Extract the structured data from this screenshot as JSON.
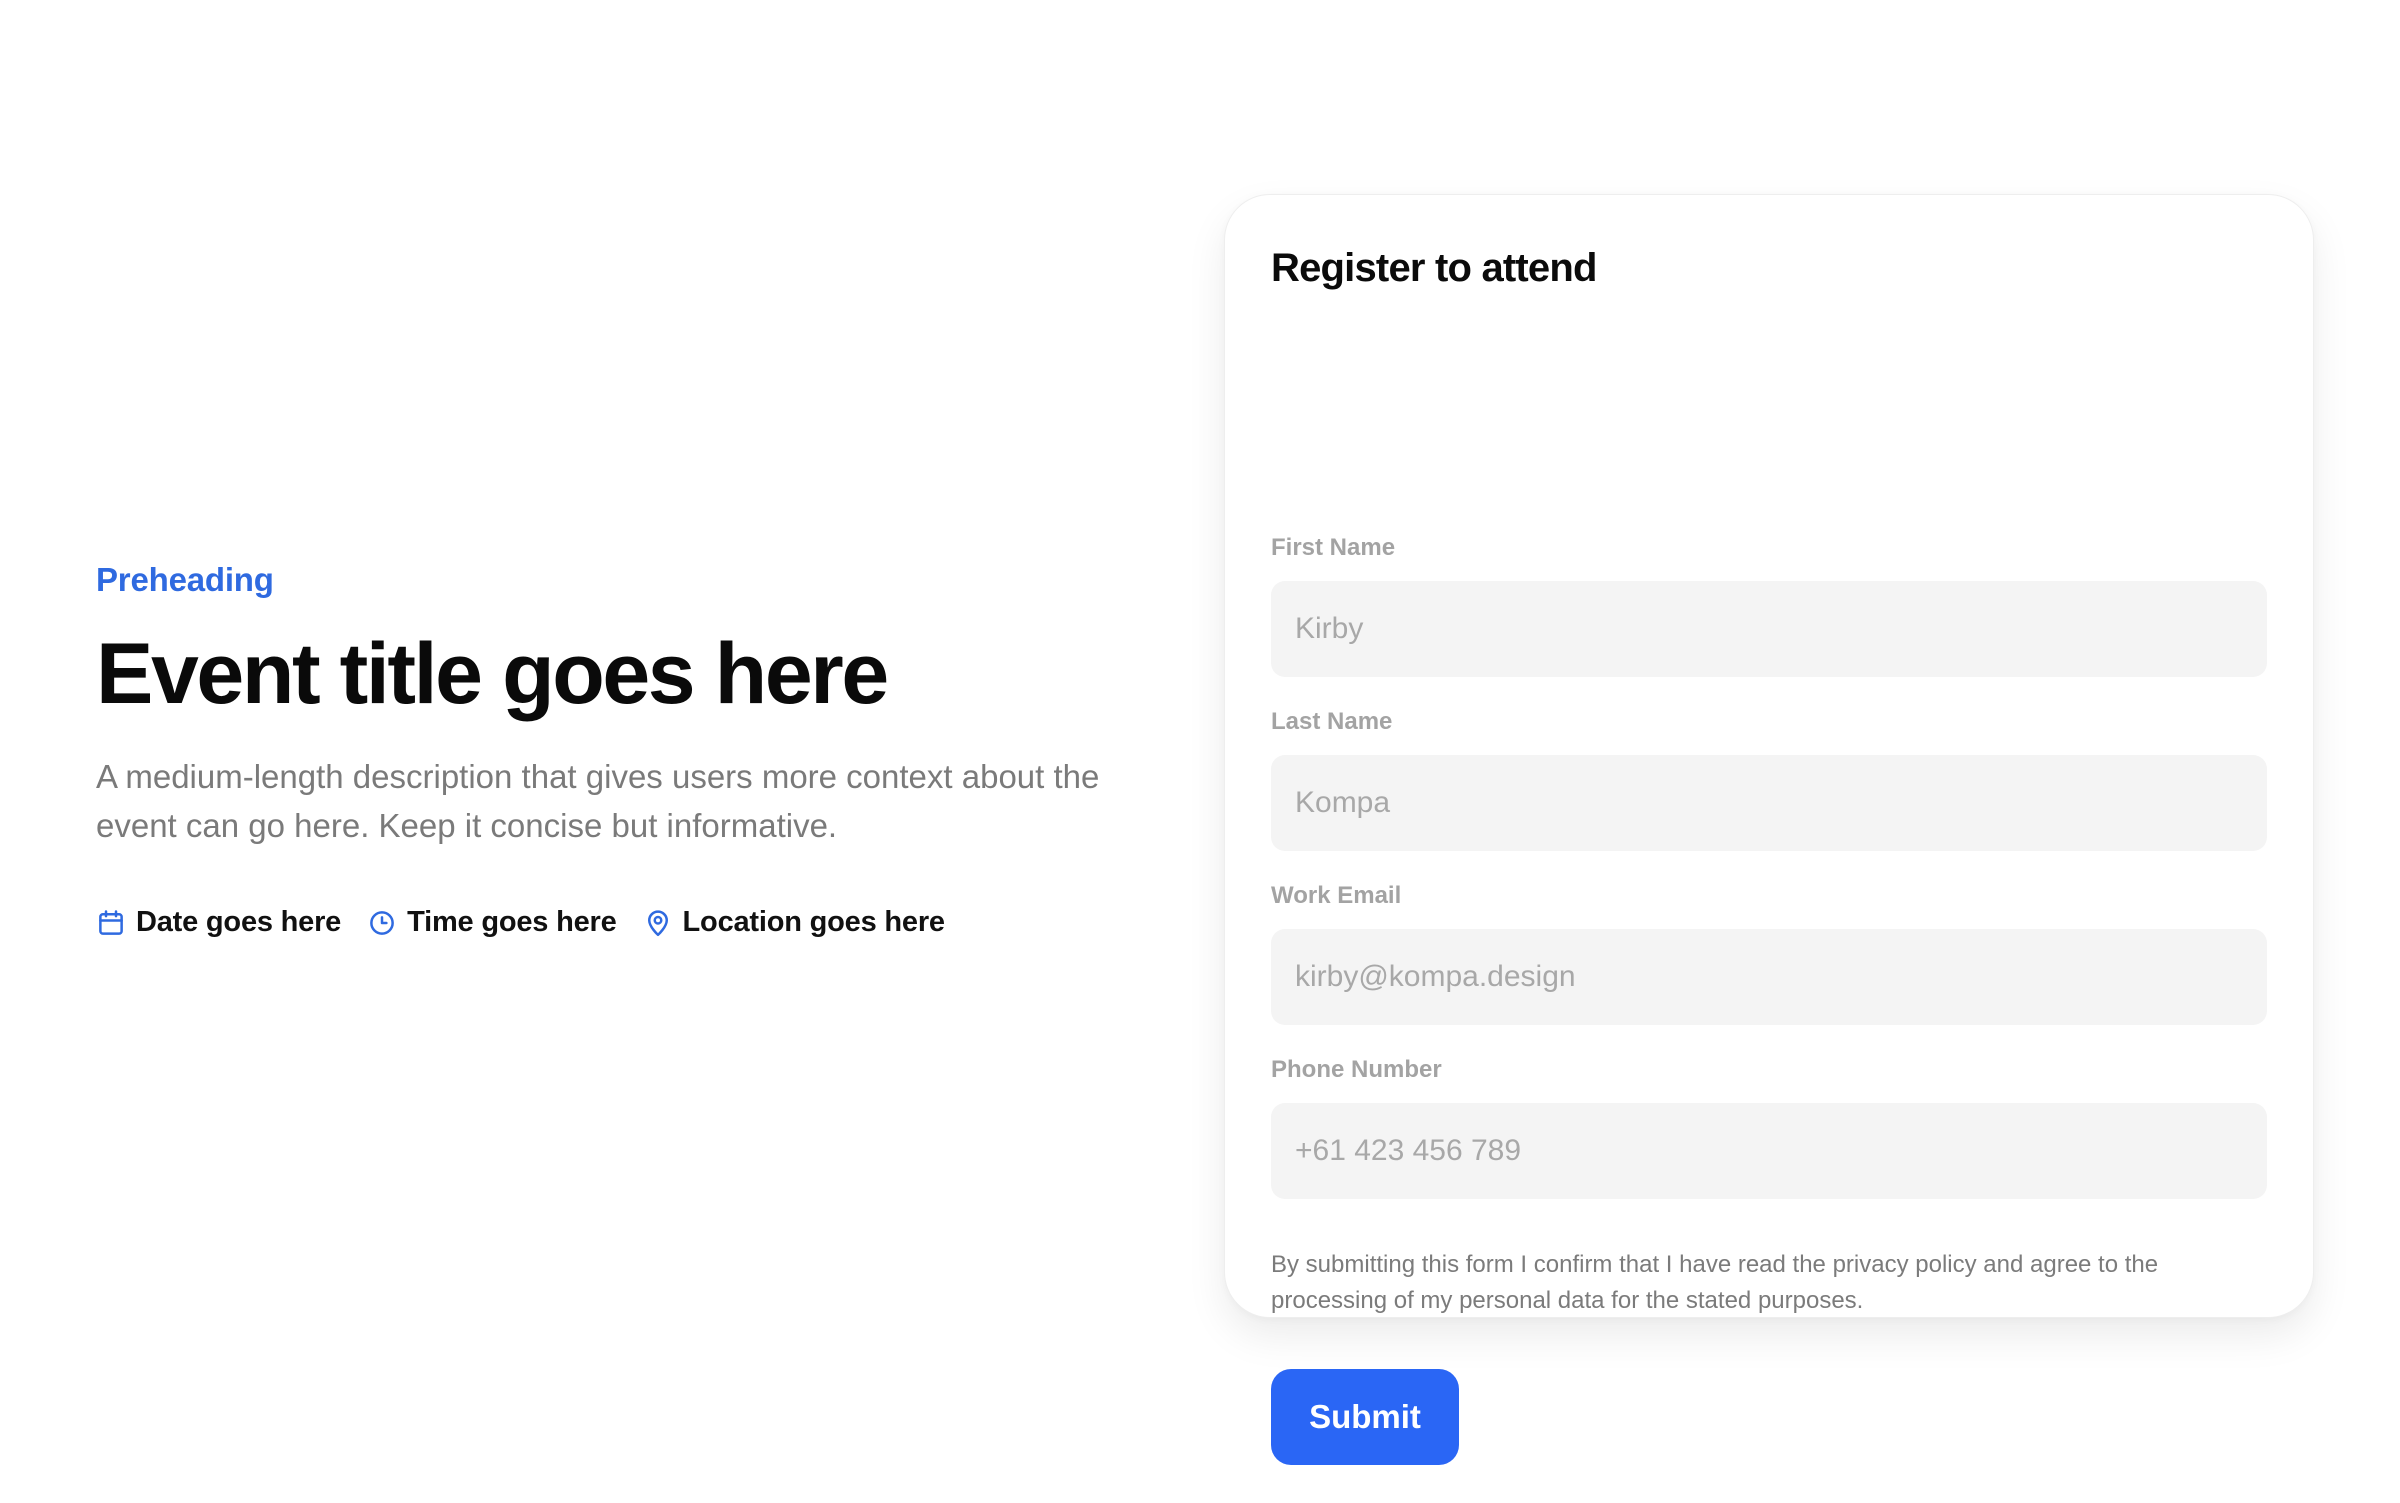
{
  "hero": {
    "preheading": "Preheading",
    "title": "Event title goes here",
    "description": "A medium-length description that gives users more context about the event can go here. Keep it concise but informative.",
    "meta": [
      {
        "icon": "calendar-icon",
        "label": "Date goes here"
      },
      {
        "icon": "clock-icon",
        "label": "Time goes here"
      },
      {
        "icon": "map-pin-icon",
        "label": "Location goes here"
      }
    ]
  },
  "form": {
    "title": "Register to attend",
    "fields": [
      {
        "label": "First Name",
        "placeholder": "Kirby",
        "value": ""
      },
      {
        "label": "Last Name",
        "placeholder": "Kompa",
        "value": ""
      },
      {
        "label": "Work Email",
        "placeholder": "kirby@kompa.design",
        "value": ""
      },
      {
        "label": "Phone Number",
        "placeholder": "+61 423 456 789",
        "value": ""
      }
    ],
    "consent": "By submitting this form I confirm that I have read the privacy policy and agree to the processing of my personal data for the stated purposes.",
    "submit_label": "Submit"
  },
  "colors": {
    "accent": "#2a66f5",
    "preheading": "#2f6ae0",
    "input_bg": "#f4f4f4",
    "muted_text": "#7a7a7a"
  }
}
